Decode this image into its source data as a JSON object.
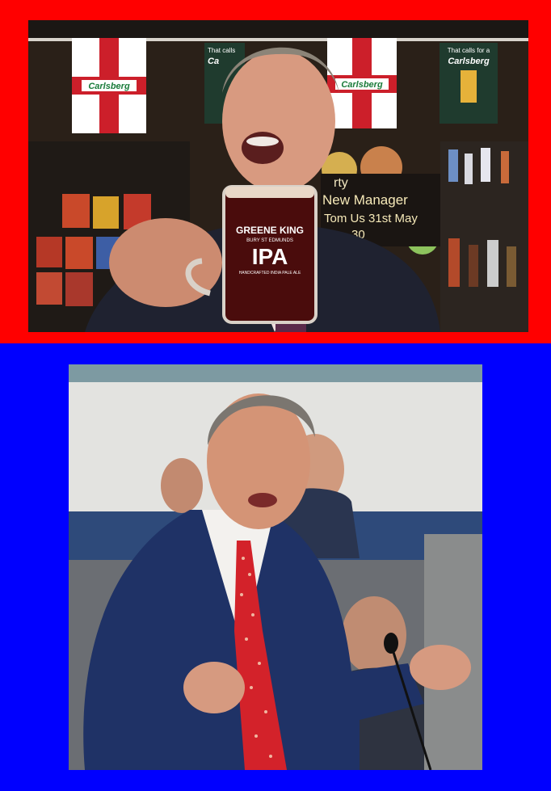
{
  "colors": {
    "top_frame": "#ff0000",
    "bottom_frame": "#0000ff"
  },
  "top_photo": {
    "bunting_flags": [
      {
        "brand": "Carlsberg"
      },
      {
        "brand": "Carlsberg"
      }
    ],
    "posters": [
      {
        "line1": "That calls for a",
        "brand": "Carlsberg"
      },
      {
        "line1": "That calls",
        "brand": "Ca"
      }
    ],
    "glass": {
      "brand_line1": "GREENE KING",
      "brand_line2": "BURY ST EDMUNDS",
      "product": "IPA",
      "subline": "HANDCRAFTED INDIA PALE ALE"
    },
    "chalkboard": {
      "line1": "rty",
      "line2": "New Manager",
      "line3": "Tom Us 31st May",
      "line4": "30"
    }
  }
}
